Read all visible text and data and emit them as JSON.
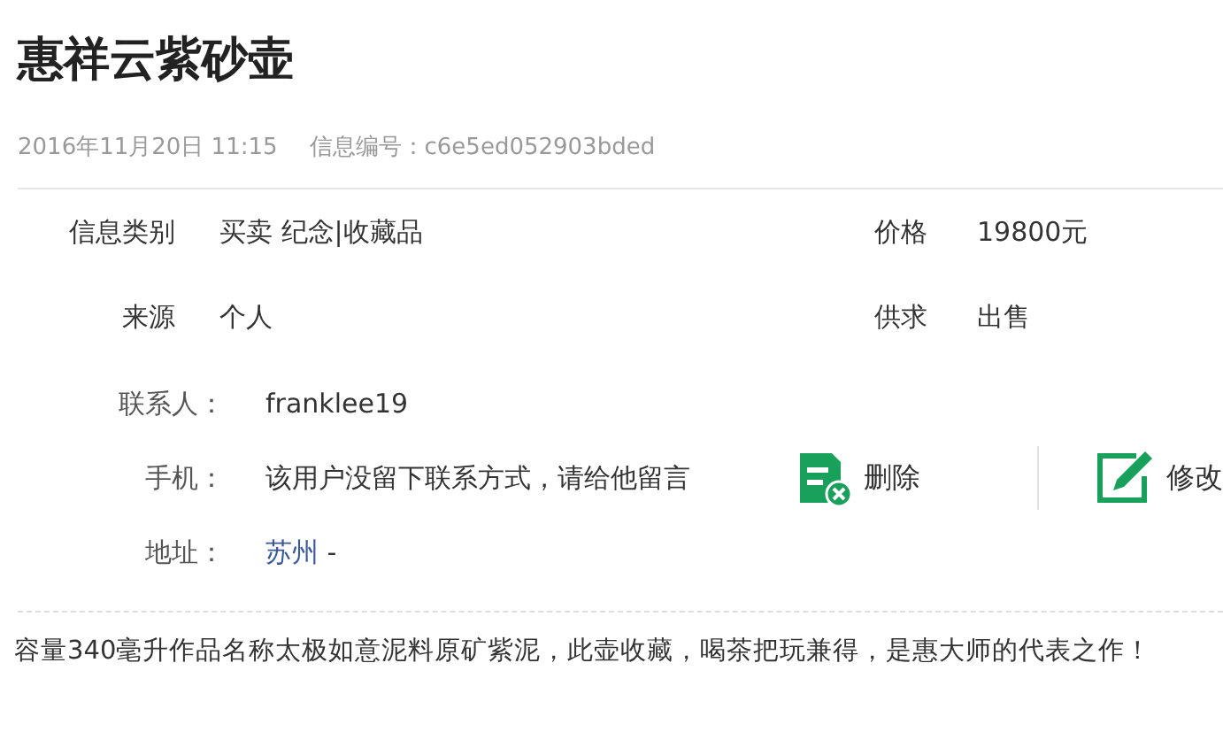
{
  "title": "惠祥云紫砂壶",
  "meta": {
    "date": "2016年11月20日 11:15",
    "info_id": "信息编号：c6e5ed052903bded"
  },
  "fields": [
    {
      "label": "信息类别",
      "value": "买卖 纪念|收藏品",
      "side_label": "价格",
      "side_value": "19800元"
    },
    {
      "label": "来源",
      "value": "个人",
      "side_label": "供求",
      "side_value": "出售"
    }
  ],
  "contact": {
    "label": "联系人：",
    "value": "franklee19"
  },
  "phone": {
    "label": "手机：",
    "value": "该用户没留下联系方式，请给他留言"
  },
  "address": {
    "label": "地址：",
    "city": "苏州",
    "suffix": "-"
  },
  "actions": [
    {
      "kind": "delete",
      "label": "删除"
    },
    {
      "kind": "edit",
      "label": "修改"
    }
  ],
  "description": "容量340毫升作品名称太极如意泥料原矿紫泥，此壶收藏，喝茶把玩兼得，是惠大师的代表之作！"
}
